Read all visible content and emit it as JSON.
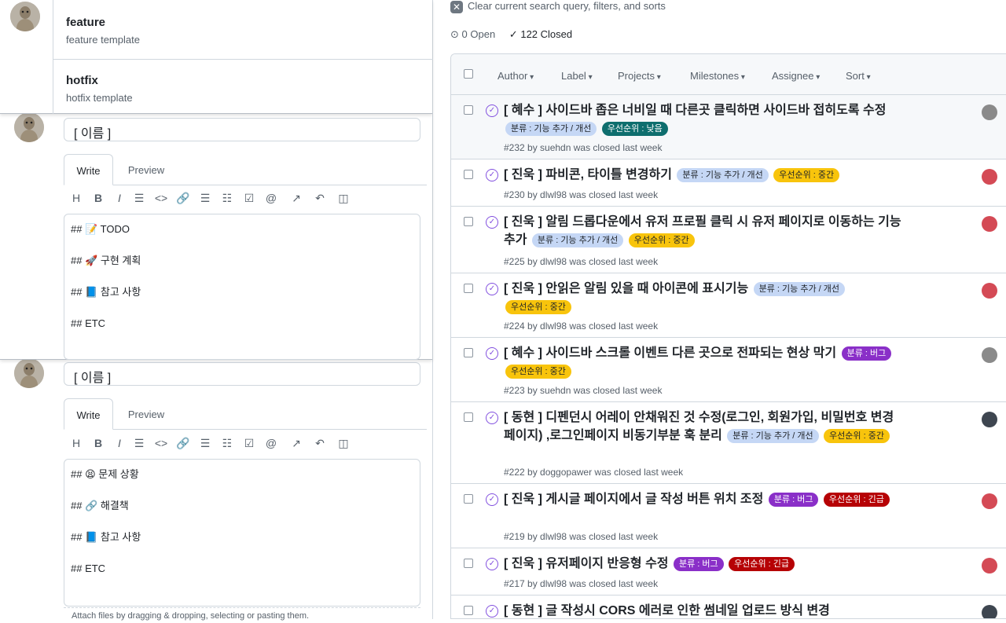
{
  "templates": [
    {
      "name": "feature",
      "description": "feature template"
    },
    {
      "name": "hotfix",
      "description": "hotfix template"
    }
  ],
  "editors": [
    {
      "title": "[ 이름 ]",
      "tab_write": "Write",
      "tab_preview": "Preview",
      "lines": [
        "## 📝 TODO",
        "## 🚀 구현 계획",
        "## 📘 참고 사항",
        "## ETC"
      ]
    },
    {
      "title": "[ 이름 ]",
      "tab_write": "Write",
      "tab_preview": "Preview",
      "lines": [
        "## 😫 문제 상황",
        "## 🔗 해결책",
        "## 📘 참고 사항",
        "## ETC"
      ],
      "attach_hint": "Attach files by dragging & dropping, selecting or pasting them."
    }
  ],
  "toolbar_icons": [
    "heading-icon",
    "bold-icon",
    "italic-icon",
    "quote-icon",
    "code-icon",
    "link-icon",
    "bulleted-list-icon",
    "numbered-list-icon",
    "task-list-icon",
    "mention-icon",
    "reference-icon",
    "reply-icon",
    "saved-replies-icon"
  ],
  "toolbar_glyphs": [
    "H",
    "B",
    "I",
    "☰",
    "<>",
    "🔗",
    "☰",
    "☷",
    "☑",
    "@",
    "↗",
    "↶",
    "◫"
  ],
  "issues_page": {
    "clear_text": "Clear current search query, filters, and sorts",
    "open_count": "0 Open",
    "closed_count": "122 Closed",
    "filters": [
      "Author",
      "Label",
      "Projects",
      "Milestones",
      "Assignee",
      "Sort"
    ]
  },
  "label_colors": {
    "feature": {
      "bg": "#c5d7f5",
      "fg": "#1f2328"
    },
    "low": {
      "bg": "#0e6e6e",
      "fg": "#ffffff"
    },
    "medium": {
      "bg": "#f8c40c",
      "fg": "#1f2328"
    },
    "bug": {
      "bg": "#8a2fc8",
      "fg": "#ffffff"
    },
    "urgent": {
      "bg": "#b60205",
      "fg": "#ffffff"
    }
  },
  "issues": [
    {
      "title": "[ 혜수 ] 사이드바 좁은 너비일 때 다른곳 클릭하면 사이드바 접히도록 수정",
      "labels": [
        {
          "text": "분류 : 기능 추가 / 개선",
          "kind": "feature"
        },
        {
          "text": "우선순위 : 낮음",
          "kind": "low"
        }
      ],
      "meta": "#232 by suehdn was closed last week"
    },
    {
      "title": "[ 진욱 ] 파비콘, 타이틀 변경하기",
      "labels": [
        {
          "text": "분류 : 기능 추가 / 개선",
          "kind": "feature"
        },
        {
          "text": "우선순위 : 중간",
          "kind": "medium"
        }
      ],
      "meta": "#230 by dlwl98 was closed last week"
    },
    {
      "title": "[ 진욱 ] 알림 드롭다운에서 유저 프로필 클릭 시 유저 페이지로 이동하는 기능 추가",
      "labels": [
        {
          "text": "분류 : 기능 추가 / 개선",
          "kind": "feature"
        },
        {
          "text": "우선순위 : 중간",
          "kind": "medium"
        }
      ],
      "meta": "#225 by dlwl98 was closed last week"
    },
    {
      "title": "[ 진욱 ] 안읽은 알림 있을 때 아이콘에 표시기능",
      "labels": [
        {
          "text": "분류 : 기능 추가 / 개선",
          "kind": "feature"
        },
        {
          "text": "우선순위 : 중간",
          "kind": "medium"
        }
      ],
      "meta": "#224 by dlwl98 was closed last week"
    },
    {
      "title": "[ 혜수 ] 사이드바 스크롤 이벤트 다른 곳으로 전파되는 현상 막기",
      "labels": [
        {
          "text": "분류 : 버그",
          "kind": "bug"
        },
        {
          "text": "우선순위 : 중간",
          "kind": "medium"
        }
      ],
      "meta": "#223 by suehdn was closed last week"
    },
    {
      "title": "[ 동현 ] 디펜던시 어레이 안채워진 것 수정(로그인, 회원가입, 비밀번호 변경페이지) ,로그인페이지 비동기부분 훅 분리",
      "labels": [
        {
          "text": "분류 : 기능 추가 / 개선",
          "kind": "feature"
        },
        {
          "text": "우선순위 : 중간",
          "kind": "medium"
        }
      ],
      "meta": "#222 by doggopawer was closed last week"
    },
    {
      "title": "[ 진욱 ] 게시글 페이지에서 글 작성 버튼 위치 조정",
      "labels": [
        {
          "text": "분류 : 버그",
          "kind": "bug"
        },
        {
          "text": "우선순위 : 긴급",
          "kind": "urgent"
        }
      ],
      "meta": "#219 by dlwl98 was closed last week"
    },
    {
      "title": "[ 진욱 ] 유저페이지 반응형 수정",
      "labels": [
        {
          "text": "분류 : 버그",
          "kind": "bug"
        },
        {
          "text": "우선순위 : 긴급",
          "kind": "urgent"
        }
      ],
      "meta": "#217 by dlwl98 was closed last week"
    },
    {
      "title": "[ 동현 ] 글 작성시 CORS 에러로 인한 썸네일 업로드 방식 변경",
      "labels": [],
      "meta": ""
    }
  ]
}
